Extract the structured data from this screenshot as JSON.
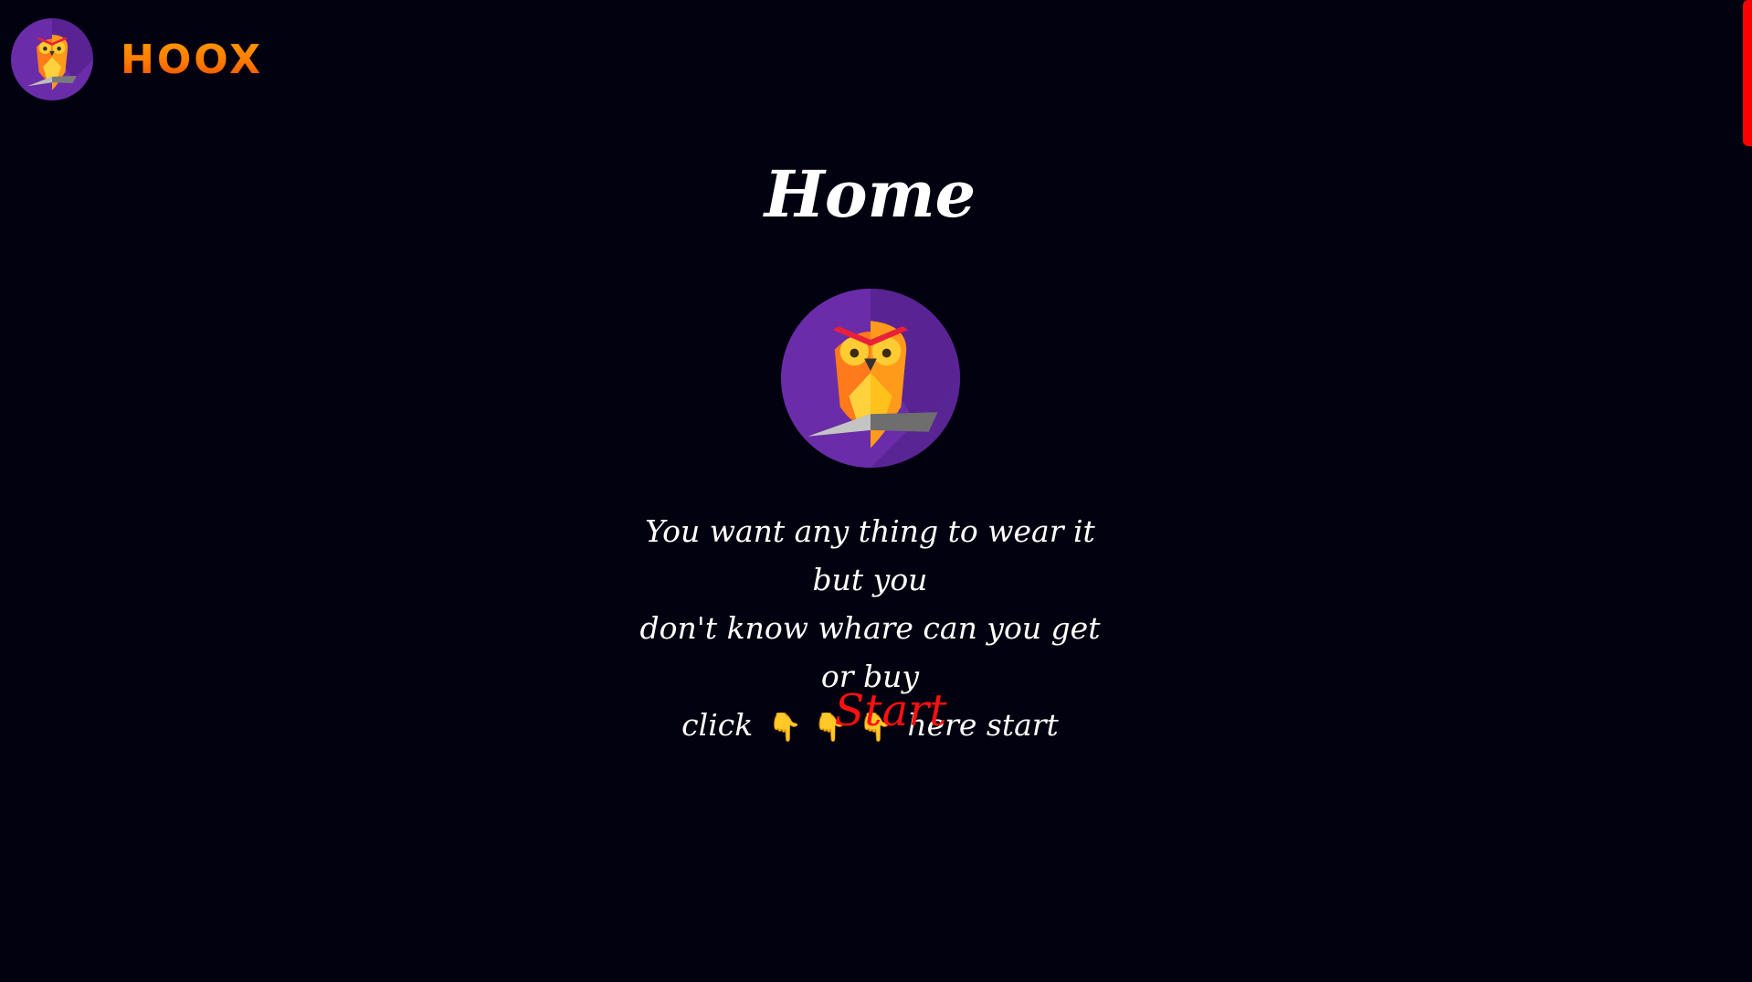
{
  "brand": {
    "name": "HOOX",
    "logo_icon": "owl-logo-icon"
  },
  "main": {
    "title": "Home",
    "hero_icon": "owl-logo-icon",
    "description_line1": "You want any thing to wear it but you",
    "description_line2": "don't know whare can you get or buy",
    "description_line3_start": "click",
    "hand_glyph": "👇",
    "description_line3_end": "here start",
    "start_label": "Start"
  },
  "colors": {
    "background": "#02010f",
    "accent": "#ff1010",
    "brand_gradient_top": "#ffb000",
    "brand_gradient_bottom": "#e03a00",
    "owl_circle": "#6a2ca8"
  }
}
